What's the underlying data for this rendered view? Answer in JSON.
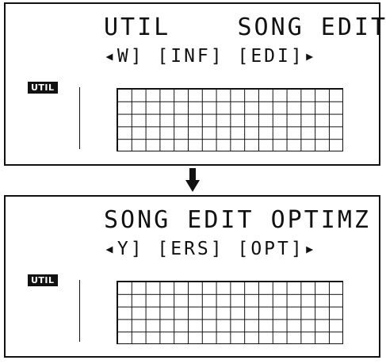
{
  "panels": [
    {
      "title": "UTIL    SONG EDIT",
      "menu": "◂W] [INF] [EDI]▸",
      "badge": "UTIL"
    },
    {
      "title": "SONG EDIT OPTIMZ",
      "menu": "◂Y] [ERS] [OPT]▸",
      "badge": "UTIL"
    }
  ],
  "arrow_icon": "down-arrow-icon",
  "colors": {
    "ink": "#111111",
    "background": "#ffffff"
  }
}
